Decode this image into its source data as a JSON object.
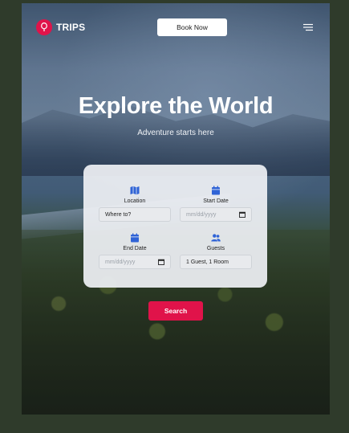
{
  "brand": {
    "name": "TRIPS",
    "accent": "#e0134a"
  },
  "navbar": {
    "book_label": "Book Now"
  },
  "hero": {
    "title": "Explore the World",
    "subtitle": "Adventure starts here"
  },
  "form": {
    "location": {
      "label": "Location",
      "value": "Where to?",
      "icon": "map-icon"
    },
    "start_date": {
      "label": "Start Date",
      "placeholder": "mm/dd/yyyy",
      "icon": "calendar-icon"
    },
    "end_date": {
      "label": "End Date",
      "placeholder": "mm/dd/yyyy",
      "icon": "calendar-icon"
    },
    "guests": {
      "label": "Guests",
      "value": "1 Guest, 1 Room",
      "icon": "users-icon"
    },
    "search_label": "Search"
  },
  "colors": {
    "icon_blue": "#2f63d6",
    "card_bg": "#eef0f4"
  }
}
